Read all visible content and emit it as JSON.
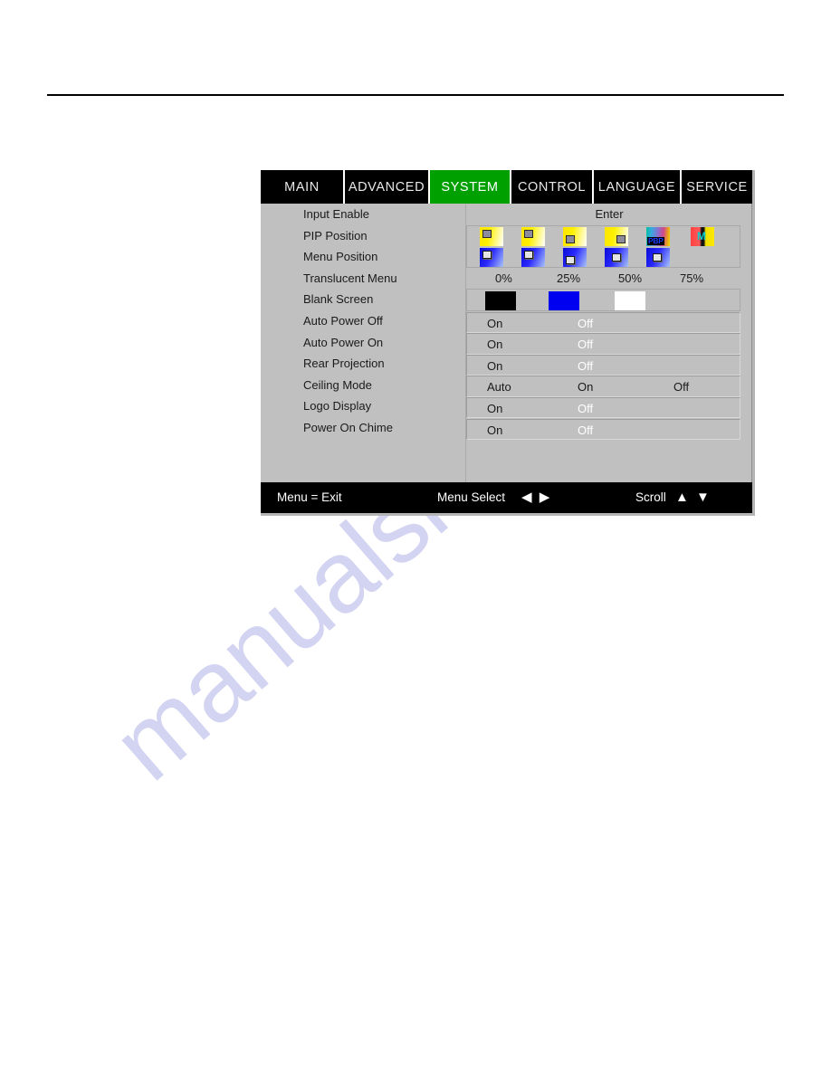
{
  "page": {
    "watermark_text": "manualshive.com"
  },
  "osd": {
    "tabs": [
      {
        "label": "MAIN",
        "selected": false,
        "width_class": "tab-w-main"
      },
      {
        "label": "ADVANCED",
        "selected": false,
        "width_class": "tab-w-advanced"
      },
      {
        "label": "SYSTEM",
        "selected": true,
        "width_class": "tab-w-system"
      },
      {
        "label": "CONTROL",
        "selected": false,
        "width_class": "tab-w-control"
      },
      {
        "label": "LANGUAGE",
        "selected": false,
        "width_class": "tab-w-language"
      },
      {
        "label": "SERVICE",
        "selected": false,
        "width_class": "tab-w-service"
      }
    ],
    "selected_tab": "SYSTEM",
    "menu_items": [
      {
        "label": "Input Enable"
      },
      {
        "label": "PIP Position"
      },
      {
        "label": "Menu Position"
      },
      {
        "label": "Translucent Menu"
      },
      {
        "label": "Blank Screen"
      },
      {
        "label": "Auto Power Off"
      },
      {
        "label": "Auto Power On"
      },
      {
        "label": "Rear Projection"
      },
      {
        "label": "Ceiling Mode"
      },
      {
        "label": "Logo Display"
      },
      {
        "label": "Power On Chime"
      }
    ],
    "input_enable": {
      "action_label": "Enter"
    },
    "pip_position": {
      "icons": [
        {
          "name": "pip-top-left",
          "kind": "split",
          "top_inner": "top-left",
          "bottom_inner": "top-left"
        },
        {
          "name": "pip-top-left-2",
          "kind": "split",
          "top_inner": "top-left",
          "bottom_inner": "top-left"
        },
        {
          "name": "pip-bottom-right",
          "kind": "split",
          "top_inner": "bottom-left",
          "bottom_inner": "bottom-left"
        },
        {
          "name": "pip-bottom-mid",
          "kind": "split",
          "top_inner": "bottom-right",
          "bottom_inner": "center"
        },
        {
          "name": "pip-pbp",
          "kind": "pbp",
          "label": "PBP"
        },
        {
          "name": "pip-multi",
          "kind": "multi",
          "label": "M"
        }
      ]
    },
    "translucent_menu": {
      "options": [
        "0%",
        "25%",
        "50%",
        "75%"
      ],
      "selected": "0%"
    },
    "blank_screen": {
      "swatches": [
        {
          "name": "black-swatch",
          "color": "#000000"
        },
        {
          "name": "blue-swatch",
          "color": "#0000f0"
        },
        {
          "name": "white-swatch",
          "color": "#ffffff"
        }
      ]
    },
    "toggle_rows": [
      {
        "row": "auto-power-off",
        "options": [
          {
            "label": "On",
            "state": "dark"
          },
          {
            "label": "Off",
            "state": "light"
          }
        ]
      },
      {
        "row": "auto-power-on",
        "options": [
          {
            "label": "On",
            "state": "dark"
          },
          {
            "label": "Off",
            "state": "light"
          }
        ]
      },
      {
        "row": "rear-projection",
        "options": [
          {
            "label": "On",
            "state": "dark"
          },
          {
            "label": "Off",
            "state": "light"
          }
        ]
      },
      {
        "row": "ceiling-mode",
        "options": [
          {
            "label": "Auto",
            "state": "dark"
          },
          {
            "label": "On",
            "state": "dark"
          },
          {
            "label": "Off",
            "state": "dark"
          }
        ]
      },
      {
        "row": "logo-display",
        "options": [
          {
            "label": "On",
            "state": "dark"
          },
          {
            "label": "Off",
            "state": "light"
          }
        ]
      },
      {
        "row": "power-on-chime",
        "options": [
          {
            "label": "On",
            "state": "dark"
          },
          {
            "label": "Off",
            "state": "light"
          }
        ]
      }
    ],
    "status_bar": {
      "exit_label": "Menu = Exit",
      "select_label": "Menu Select",
      "select_arrows": "◀ ▶",
      "scroll_label": "Scroll",
      "scroll_arrows": "▲ ▼"
    }
  },
  "colors": {
    "tab_selected_bg": "#00a000",
    "panel_bg": "#c0c0c0",
    "bar_bg": "#000000",
    "text_dark": "#1a1a1a",
    "text_light": "#ffffff",
    "watermark": "#d3d3f2"
  }
}
